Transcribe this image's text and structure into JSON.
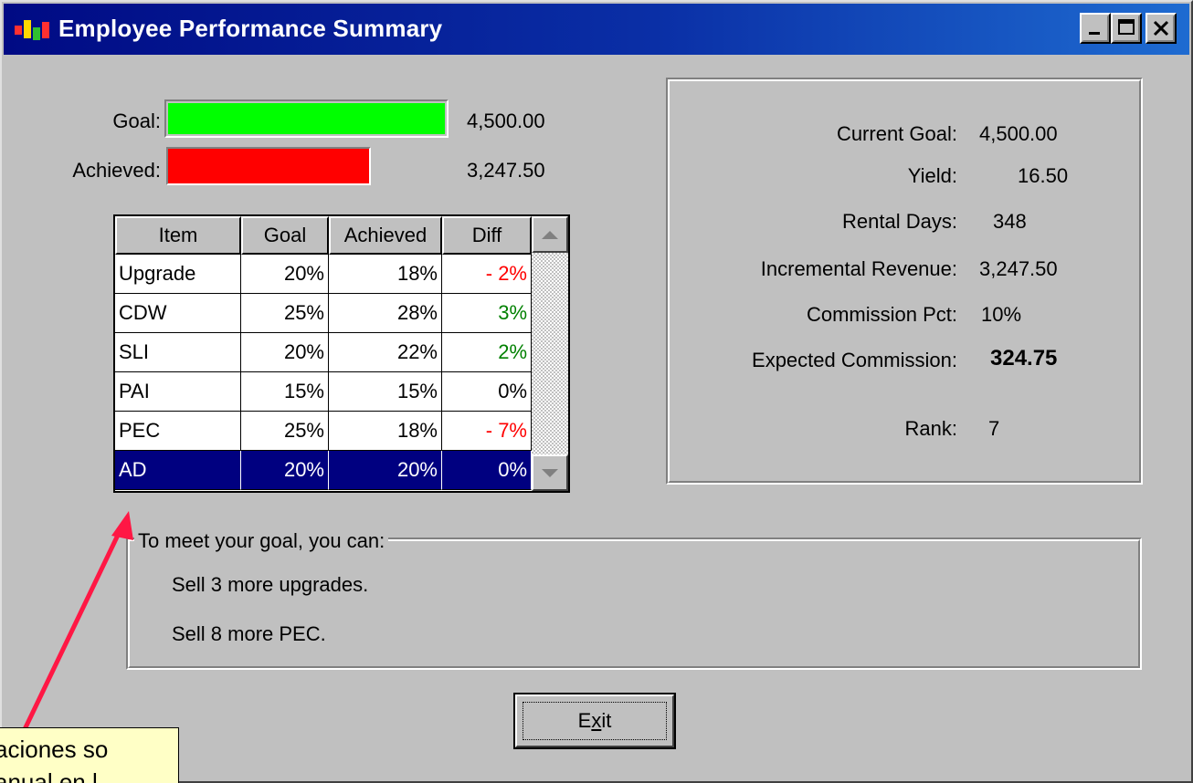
{
  "window": {
    "title": "Employee Performance Summary",
    "icon": "app-icon",
    "controls": [
      "minimize-icon",
      "maximize-icon",
      "close-icon"
    ]
  },
  "progress": {
    "goal_label": "Goal:",
    "goal_value": "4,500.00",
    "goal_fraction": 1.0,
    "goal_color": "#00ff00",
    "achieved_label": "Achieved:",
    "achieved_value": "3,247.50",
    "achieved_fraction": 0.7217,
    "achieved_color": "#ff0000"
  },
  "grid": {
    "headers": [
      "Item",
      "Goal",
      "Achieved",
      "Diff"
    ],
    "rows": [
      {
        "item": "Upgrade",
        "goal": "20%",
        "achieved": "18%",
        "diff": "- 2%",
        "diff_color": "#ff0000"
      },
      {
        "item": "CDW",
        "goal": "25%",
        "achieved": "28%",
        "diff": "3%",
        "diff_color": "#008000"
      },
      {
        "item": "SLI",
        "goal": "20%",
        "achieved": "22%",
        "diff": "2%",
        "diff_color": "#008000"
      },
      {
        "item": "PAI",
        "goal": "15%",
        "achieved": "15%",
        "diff": "0%",
        "diff_color": "#000000"
      },
      {
        "item": "PEC",
        "goal": "25%",
        "achieved": "18%",
        "diff": "- 7%",
        "diff_color": "#ff0000"
      },
      {
        "item": "AD",
        "goal": "20%",
        "achieved": "20%",
        "diff": "0%",
        "diff_color": "#ffffff",
        "selected": true
      }
    ]
  },
  "stats": {
    "current_goal_label": "Current Goal:",
    "current_goal": "4,500.00",
    "yield_label": "Yield:",
    "yield": "16.50",
    "rental_days_label": "Rental Days:",
    "rental_days": "348",
    "incremental_revenue_label": "Incremental Revenue:",
    "incremental_revenue": "3,247.50",
    "commission_pct_label": "Commission Pct:",
    "commission_pct": "10%",
    "expected_commission_label": "Expected Commission:",
    "expected_commission": "324.75",
    "rank_label": "Rank:",
    "rank": "7"
  },
  "suggestions": {
    "title": "To meet your goal, you can:",
    "items": [
      "Sell 3 more upgrades.",
      "Sell 8 more PEC."
    ]
  },
  "buttons": {
    "exit_label": "Exit"
  },
  "callout": {
    "line1": "aciones so",
    "line2": "anual en l"
  },
  "colors": {
    "titlebar": "#000a84",
    "selection": "#000080",
    "arrow": "#ff1744"
  }
}
